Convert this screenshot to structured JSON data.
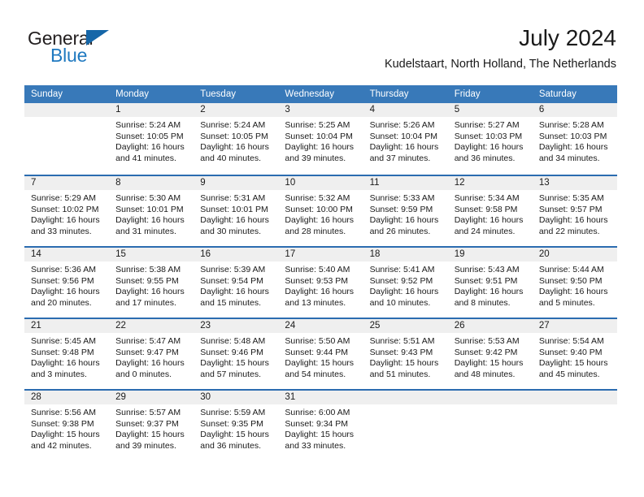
{
  "brand": {
    "line1": "General",
    "line2": "Blue",
    "triangle_color": "#1566a8",
    "blue_color": "#1f79c0"
  },
  "header": {
    "title": "July 2024",
    "subtitle": "Kudelstaart, North Holland, The Netherlands"
  },
  "theme": {
    "header_bg": "#3879b9",
    "week_divider": "#2b6cb0",
    "daynum_band_bg": "#efefef"
  },
  "weekdays": [
    "Sunday",
    "Monday",
    "Tuesday",
    "Wednesday",
    "Thursday",
    "Friday",
    "Saturday"
  ],
  "weeks": [
    [
      {
        "day": "",
        "sunrise": "",
        "sunset": "",
        "daylight1": "",
        "daylight2": "",
        "empty": true
      },
      {
        "day": "1",
        "sunrise": "Sunrise: 5:24 AM",
        "sunset": "Sunset: 10:05 PM",
        "daylight1": "Daylight: 16 hours",
        "daylight2": "and 41 minutes."
      },
      {
        "day": "2",
        "sunrise": "Sunrise: 5:24 AM",
        "sunset": "Sunset: 10:05 PM",
        "daylight1": "Daylight: 16 hours",
        "daylight2": "and 40 minutes."
      },
      {
        "day": "3",
        "sunrise": "Sunrise: 5:25 AM",
        "sunset": "Sunset: 10:04 PM",
        "daylight1": "Daylight: 16 hours",
        "daylight2": "and 39 minutes."
      },
      {
        "day": "4",
        "sunrise": "Sunrise: 5:26 AM",
        "sunset": "Sunset: 10:04 PM",
        "daylight1": "Daylight: 16 hours",
        "daylight2": "and 37 minutes."
      },
      {
        "day": "5",
        "sunrise": "Sunrise: 5:27 AM",
        "sunset": "Sunset: 10:03 PM",
        "daylight1": "Daylight: 16 hours",
        "daylight2": "and 36 minutes."
      },
      {
        "day": "6",
        "sunrise": "Sunrise: 5:28 AM",
        "sunset": "Sunset: 10:03 PM",
        "daylight1": "Daylight: 16 hours",
        "daylight2": "and 34 minutes."
      }
    ],
    [
      {
        "day": "7",
        "sunrise": "Sunrise: 5:29 AM",
        "sunset": "Sunset: 10:02 PM",
        "daylight1": "Daylight: 16 hours",
        "daylight2": "and 33 minutes."
      },
      {
        "day": "8",
        "sunrise": "Sunrise: 5:30 AM",
        "sunset": "Sunset: 10:01 PM",
        "daylight1": "Daylight: 16 hours",
        "daylight2": "and 31 minutes."
      },
      {
        "day": "9",
        "sunrise": "Sunrise: 5:31 AM",
        "sunset": "Sunset: 10:01 PM",
        "daylight1": "Daylight: 16 hours",
        "daylight2": "and 30 minutes."
      },
      {
        "day": "10",
        "sunrise": "Sunrise: 5:32 AM",
        "sunset": "Sunset: 10:00 PM",
        "daylight1": "Daylight: 16 hours",
        "daylight2": "and 28 minutes."
      },
      {
        "day": "11",
        "sunrise": "Sunrise: 5:33 AM",
        "sunset": "Sunset: 9:59 PM",
        "daylight1": "Daylight: 16 hours",
        "daylight2": "and 26 minutes."
      },
      {
        "day": "12",
        "sunrise": "Sunrise: 5:34 AM",
        "sunset": "Sunset: 9:58 PM",
        "daylight1": "Daylight: 16 hours",
        "daylight2": "and 24 minutes."
      },
      {
        "day": "13",
        "sunrise": "Sunrise: 5:35 AM",
        "sunset": "Sunset: 9:57 PM",
        "daylight1": "Daylight: 16 hours",
        "daylight2": "and 22 minutes."
      }
    ],
    [
      {
        "day": "14",
        "sunrise": "Sunrise: 5:36 AM",
        "sunset": "Sunset: 9:56 PM",
        "daylight1": "Daylight: 16 hours",
        "daylight2": "and 20 minutes."
      },
      {
        "day": "15",
        "sunrise": "Sunrise: 5:38 AM",
        "sunset": "Sunset: 9:55 PM",
        "daylight1": "Daylight: 16 hours",
        "daylight2": "and 17 minutes."
      },
      {
        "day": "16",
        "sunrise": "Sunrise: 5:39 AM",
        "sunset": "Sunset: 9:54 PM",
        "daylight1": "Daylight: 16 hours",
        "daylight2": "and 15 minutes."
      },
      {
        "day": "17",
        "sunrise": "Sunrise: 5:40 AM",
        "sunset": "Sunset: 9:53 PM",
        "daylight1": "Daylight: 16 hours",
        "daylight2": "and 13 minutes."
      },
      {
        "day": "18",
        "sunrise": "Sunrise: 5:41 AM",
        "sunset": "Sunset: 9:52 PM",
        "daylight1": "Daylight: 16 hours",
        "daylight2": "and 10 minutes."
      },
      {
        "day": "19",
        "sunrise": "Sunrise: 5:43 AM",
        "sunset": "Sunset: 9:51 PM",
        "daylight1": "Daylight: 16 hours",
        "daylight2": "and 8 minutes."
      },
      {
        "day": "20",
        "sunrise": "Sunrise: 5:44 AM",
        "sunset": "Sunset: 9:50 PM",
        "daylight1": "Daylight: 16 hours",
        "daylight2": "and 5 minutes."
      }
    ],
    [
      {
        "day": "21",
        "sunrise": "Sunrise: 5:45 AM",
        "sunset": "Sunset: 9:48 PM",
        "daylight1": "Daylight: 16 hours",
        "daylight2": "and 3 minutes."
      },
      {
        "day": "22",
        "sunrise": "Sunrise: 5:47 AM",
        "sunset": "Sunset: 9:47 PM",
        "daylight1": "Daylight: 16 hours",
        "daylight2": "and 0 minutes."
      },
      {
        "day": "23",
        "sunrise": "Sunrise: 5:48 AM",
        "sunset": "Sunset: 9:46 PM",
        "daylight1": "Daylight: 15 hours",
        "daylight2": "and 57 minutes."
      },
      {
        "day": "24",
        "sunrise": "Sunrise: 5:50 AM",
        "sunset": "Sunset: 9:44 PM",
        "daylight1": "Daylight: 15 hours",
        "daylight2": "and 54 minutes."
      },
      {
        "day": "25",
        "sunrise": "Sunrise: 5:51 AM",
        "sunset": "Sunset: 9:43 PM",
        "daylight1": "Daylight: 15 hours",
        "daylight2": "and 51 minutes."
      },
      {
        "day": "26",
        "sunrise": "Sunrise: 5:53 AM",
        "sunset": "Sunset: 9:42 PM",
        "daylight1": "Daylight: 15 hours",
        "daylight2": "and 48 minutes."
      },
      {
        "day": "27",
        "sunrise": "Sunrise: 5:54 AM",
        "sunset": "Sunset: 9:40 PM",
        "daylight1": "Daylight: 15 hours",
        "daylight2": "and 45 minutes."
      }
    ],
    [
      {
        "day": "28",
        "sunrise": "Sunrise: 5:56 AM",
        "sunset": "Sunset: 9:38 PM",
        "daylight1": "Daylight: 15 hours",
        "daylight2": "and 42 minutes."
      },
      {
        "day": "29",
        "sunrise": "Sunrise: 5:57 AM",
        "sunset": "Sunset: 9:37 PM",
        "daylight1": "Daylight: 15 hours",
        "daylight2": "and 39 minutes."
      },
      {
        "day": "30",
        "sunrise": "Sunrise: 5:59 AM",
        "sunset": "Sunset: 9:35 PM",
        "daylight1": "Daylight: 15 hours",
        "daylight2": "and 36 minutes."
      },
      {
        "day": "31",
        "sunrise": "Sunrise: 6:00 AM",
        "sunset": "Sunset: 9:34 PM",
        "daylight1": "Daylight: 15 hours",
        "daylight2": "and 33 minutes."
      },
      {
        "day": "",
        "sunrise": "",
        "sunset": "",
        "daylight1": "",
        "daylight2": "",
        "empty": true
      },
      {
        "day": "",
        "sunrise": "",
        "sunset": "",
        "daylight1": "",
        "daylight2": "",
        "empty": true
      },
      {
        "day": "",
        "sunrise": "",
        "sunset": "",
        "daylight1": "",
        "daylight2": "",
        "empty": true
      }
    ]
  ]
}
